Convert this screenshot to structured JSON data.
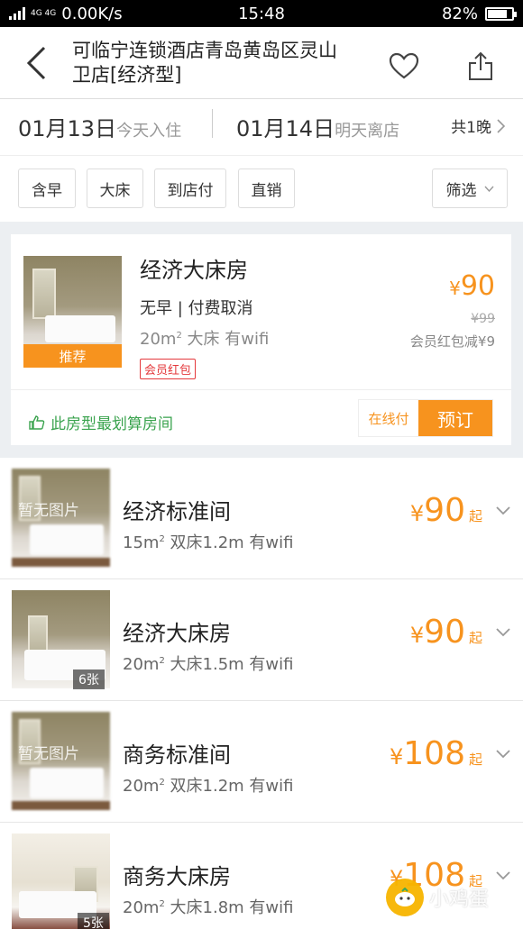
{
  "status_bar": {
    "network_label": "4G 4G",
    "speed": "0.00K/s",
    "time": "15:48",
    "battery": "82%",
    "battery_level": 0.82
  },
  "header": {
    "title": "可临宁连锁酒店青岛黄岛区灵山卫店[经济型]",
    "back_icon": "chevron-left-icon",
    "favorite_icon": "heart-icon",
    "share_icon": "share-icon"
  },
  "dates": {
    "checkin_date": "01月13日",
    "checkin_label": "今天入住",
    "checkout_date": "01月14日",
    "checkout_label": "明天离店",
    "nights": "共1晚"
  },
  "filters": {
    "items": [
      "含早",
      "大床",
      "到店付",
      "直销"
    ],
    "screen_label": "筛选"
  },
  "featured": {
    "tag": "推荐",
    "name": "经济大床房",
    "policy": "无早 | 付费取消",
    "area": "20m",
    "area_sup": "2",
    "spec": " 大床 有wifi",
    "badge": "会员红包",
    "currency": "¥",
    "price": "90",
    "old_price": "¥99",
    "discount": "会员红包减¥9",
    "tip": "此房型最划算房间",
    "pay_label": "在线付",
    "book_label": "预订"
  },
  "rooms": [
    {
      "name": "经济标准间",
      "area": "15m",
      "area_sup": "2",
      "spec": " 双床1.2m 有wifi",
      "currency": "¥",
      "price": "90",
      "suffix": "起",
      "image_label": "暂无图片",
      "photo_count": ""
    },
    {
      "name": "经济大床房",
      "area": "20m",
      "area_sup": "2",
      "spec": " 大床1.5m 有wifi",
      "currency": "¥",
      "price": "90",
      "suffix": "起",
      "image_label": "",
      "photo_count": "6张"
    },
    {
      "name": "商务标准间",
      "area": "20m",
      "area_sup": "2",
      "spec": " 双床1.2m 有wifi",
      "currency": "¥",
      "price": "108",
      "suffix": "起",
      "image_label": "暂无图片",
      "photo_count": ""
    },
    {
      "name": "商务大床房",
      "area": "20m",
      "area_sup": "2",
      "spec": " 大床1.8m 有wifi",
      "currency": "¥",
      "price": "108",
      "suffix": "起",
      "image_label": "",
      "photo_count": "5张"
    }
  ],
  "watermark": {
    "text": "小鸡蛋"
  },
  "colors": {
    "accent": "#f7931e",
    "green": "#3aa34e",
    "red": "#e4393c"
  }
}
